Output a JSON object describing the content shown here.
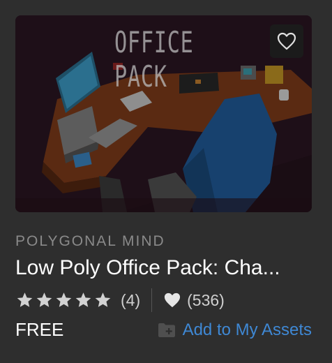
{
  "product": {
    "thumbnail_text": "OFFICE PACK",
    "publisher": "POLYGONAL MIND",
    "title": "Low Poly Office Pack: Cha...",
    "rating_count": "(4)",
    "likes_count": "(536)",
    "rating_stars": 5,
    "price": "FREE",
    "add_to_assets_label": "Add to My Assets"
  },
  "icons": {
    "favorite": "heart-outline-icon",
    "star": "star-icon",
    "likes": "heart-filled-icon",
    "add_assets": "folder-add-icon"
  },
  "colors": {
    "background": "#2e2e2e",
    "accent": "#3f88d4",
    "muted_text": "#8a8a8a"
  }
}
